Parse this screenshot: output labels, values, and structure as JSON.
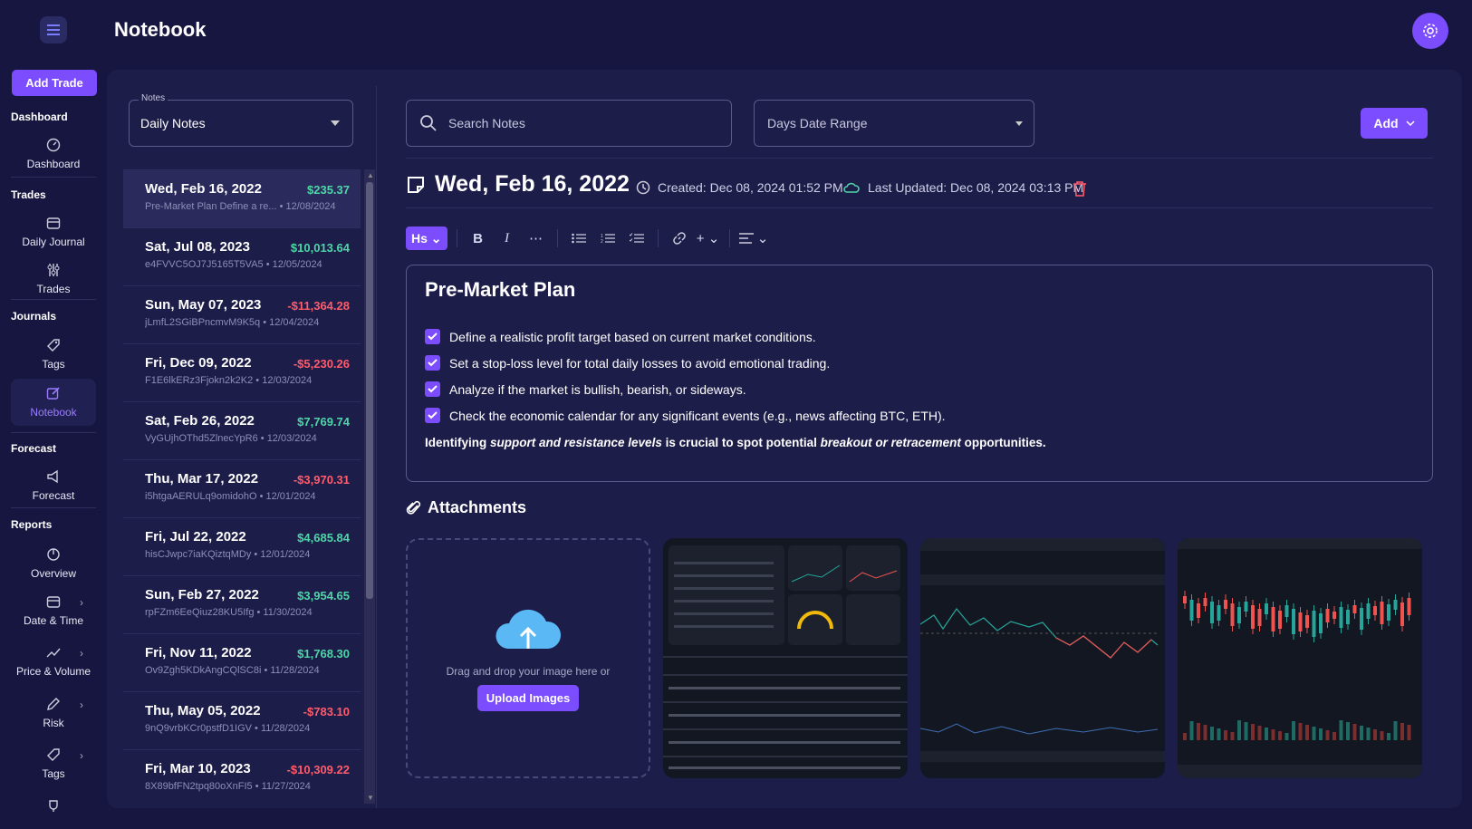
{
  "app": {
    "title": "Notebook"
  },
  "sidebar": {
    "add_trade": "Add Trade",
    "sections": {
      "dashboard": "Dashboard",
      "trades": "Trades",
      "journals": "Journals",
      "forecast": "Forecast",
      "reports": "Reports"
    },
    "items": {
      "dashboard": "Dashboard",
      "daily_journal": "Daily Journal",
      "trades": "Trades",
      "tags": "Tags",
      "notebook": "Notebook",
      "forecast": "Forecast",
      "overview": "Overview",
      "date_time": "Date & Time",
      "price_volume": "Price & Volume",
      "risk": "Risk",
      "tags2": "Tags"
    }
  },
  "notes_panel": {
    "label": "Notes",
    "selected": "Daily Notes",
    "notes": [
      {
        "date": "Wed, Feb 16, 2022",
        "amount": "$235.37",
        "sign": "pos",
        "snippet": "Pre-Market Plan Define a re...",
        "created": "12/08/2024"
      },
      {
        "date": "Sat, Jul 08, 2023",
        "amount": "$10,013.64",
        "sign": "pos",
        "snippet": "e4FVVC5OJ7J5165T5VA5",
        "created": "12/05/2024"
      },
      {
        "date": "Sun, May 07, 2023",
        "amount": "-$11,364.28",
        "sign": "neg",
        "snippet": "jLmfL2SGiBPncmvM9K5q",
        "created": "12/04/2024"
      },
      {
        "date": "Fri, Dec 09, 2022",
        "amount": "-$5,230.26",
        "sign": "neg",
        "snippet": "F1E6lkERz3Fjokn2k2K2",
        "created": "12/03/2024"
      },
      {
        "date": "Sat, Feb 26, 2022",
        "amount": "$7,769.74",
        "sign": "pos",
        "snippet": "VyGUjhOThd5ZlnecYpR6",
        "created": "12/03/2024"
      },
      {
        "date": "Thu, Mar 17, 2022",
        "amount": "-$3,970.31",
        "sign": "neg",
        "snippet": "i5htgaAERULq9omidohO",
        "created": "12/01/2024"
      },
      {
        "date": "Fri, Jul 22, 2022",
        "amount": "$4,685.84",
        "sign": "pos",
        "snippet": "hisCJwpc7iaKQiztqMDy",
        "created": "12/01/2024"
      },
      {
        "date": "Sun, Feb 27, 2022",
        "amount": "$3,954.65",
        "sign": "pos",
        "snippet": "rpFZm6EeQiuz28KU5Ifg",
        "created": "11/30/2024"
      },
      {
        "date": "Fri, Nov 11, 2022",
        "amount": "$1,768.30",
        "sign": "pos",
        "snippet": "Ov9Zgh5KDkAngCQlSC8i",
        "created": "11/28/2024"
      },
      {
        "date": "Thu, May 05, 2022",
        "amount": "-$783.10",
        "sign": "neg",
        "snippet": "9nQ9vrbKCr0pstfD1IGV",
        "created": "11/28/2024"
      },
      {
        "date": "Fri, Mar 10, 2023",
        "amount": "-$10,309.22",
        "sign": "neg",
        "snippet": "8X89bfFN2tpq80oXnFI5",
        "created": "11/27/2024"
      }
    ]
  },
  "toolbar": {
    "search_placeholder": "Search Notes",
    "range": "Days Date Range",
    "add": "Add"
  },
  "note": {
    "title": "Wed, Feb 16, 2022",
    "created": "Created: Dec 08, 2024 01:52 PM",
    "updated": "Last Updated: Dec 08, 2024 03:13 PM",
    "heading": "Pre-Market Plan",
    "checks": [
      "Define a realistic profit target based on current market conditions.",
      "Set a stop-loss level for total daily losses to avoid emotional trading.",
      "Analyze if the market is bullish, bearish, or sideways.",
      "Check the economic calendar for any significant events (e.g., news affecting BTC, ETH)."
    ],
    "para": {
      "p1": "Identifying ",
      "i1": "support and resistance levels",
      "p2": " is crucial to spot potential ",
      "i2": "breakout or retracement",
      "p3": " opportunities."
    }
  },
  "attachments": {
    "title": "Attachments",
    "drop_text": "Drag and drop your image here or",
    "upload": "Upload Images"
  },
  "editor_toolbar": {
    "heading": "Hs"
  },
  "colors": {
    "accent": "#7c4dff",
    "positive": "#4fd6a8",
    "negative": "#ff5c6c",
    "bg": "#161640",
    "panel": "#1d1d4a"
  }
}
